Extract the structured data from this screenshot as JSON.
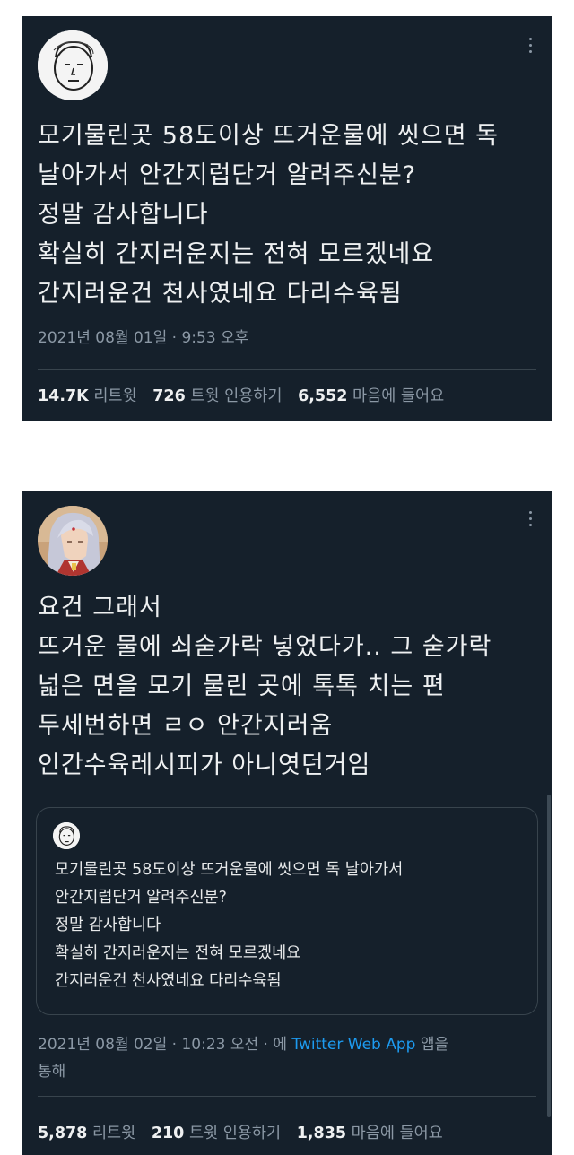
{
  "tweet1": {
    "avatar_icon": "doodle-face-avatar",
    "more_icon": "vertical-ellipsis-icon",
    "lines": [
      "모기물린곳 58도이상 뜨거운물에 씻으면 독",
      "날아가서 안간지럽단거 알려주신분?",
      "정말 감사합니다",
      "확실히 간지러운지는 전혀 모르겠네요",
      "간지러운건 천사였네요 다리수육됨"
    ],
    "timestamp": "2021년 08월 01일 · 9:53 오후",
    "stats": {
      "retweets": "14.7K",
      "retweets_label": "리트윗",
      "quotes": "726",
      "quotes_label": "트윗 인용하기",
      "likes": "6,552",
      "likes_label": "마음에 들어요"
    }
  },
  "tweet2": {
    "avatar_icon": "anime-character-avatar",
    "more_icon": "vertical-ellipsis-icon",
    "lines": [
      "요건 그래서",
      "뜨거운 물에 쇠숟가락 넣었다가.. 그 숟가락",
      "넓은 면을 모기 물린 곳에 톡톡 치는 편",
      "두세번하면 ㄹㅇ 안간지러움",
      "인간수육레시피가 아니엿던거임"
    ],
    "quote": {
      "avatar_icon": "doodle-face-avatar",
      "lines": [
        "모기물린곳 58도이상 뜨거운물에 씻으면 독 날아가서",
        "안간지럽단거 알려주신분?",
        "정말 감사합니다",
        "확실히 간지러운지는 전혀 모르겠네요",
        "간지러운건 천사였네요 다리수육됨"
      ]
    },
    "timestamp_line1": "2021년 08월 02일 · 10:23 오전 · 에 ",
    "via": "Twitter Web App",
    "timestamp_suffix": " 앱을",
    "timestamp_line2": "통해",
    "stats": {
      "retweets": "5,878",
      "retweets_label": "리트윗",
      "quotes": "210",
      "quotes_label": "트윗 인용하기",
      "likes": "1,835",
      "likes_label": "마음에 들어요"
    }
  },
  "colors": {
    "tweet_bg": "#15202b",
    "text": "#e7e9ea",
    "secondary": "#8b98a5",
    "link": "#1d9bf0",
    "divider": "#38444d"
  }
}
